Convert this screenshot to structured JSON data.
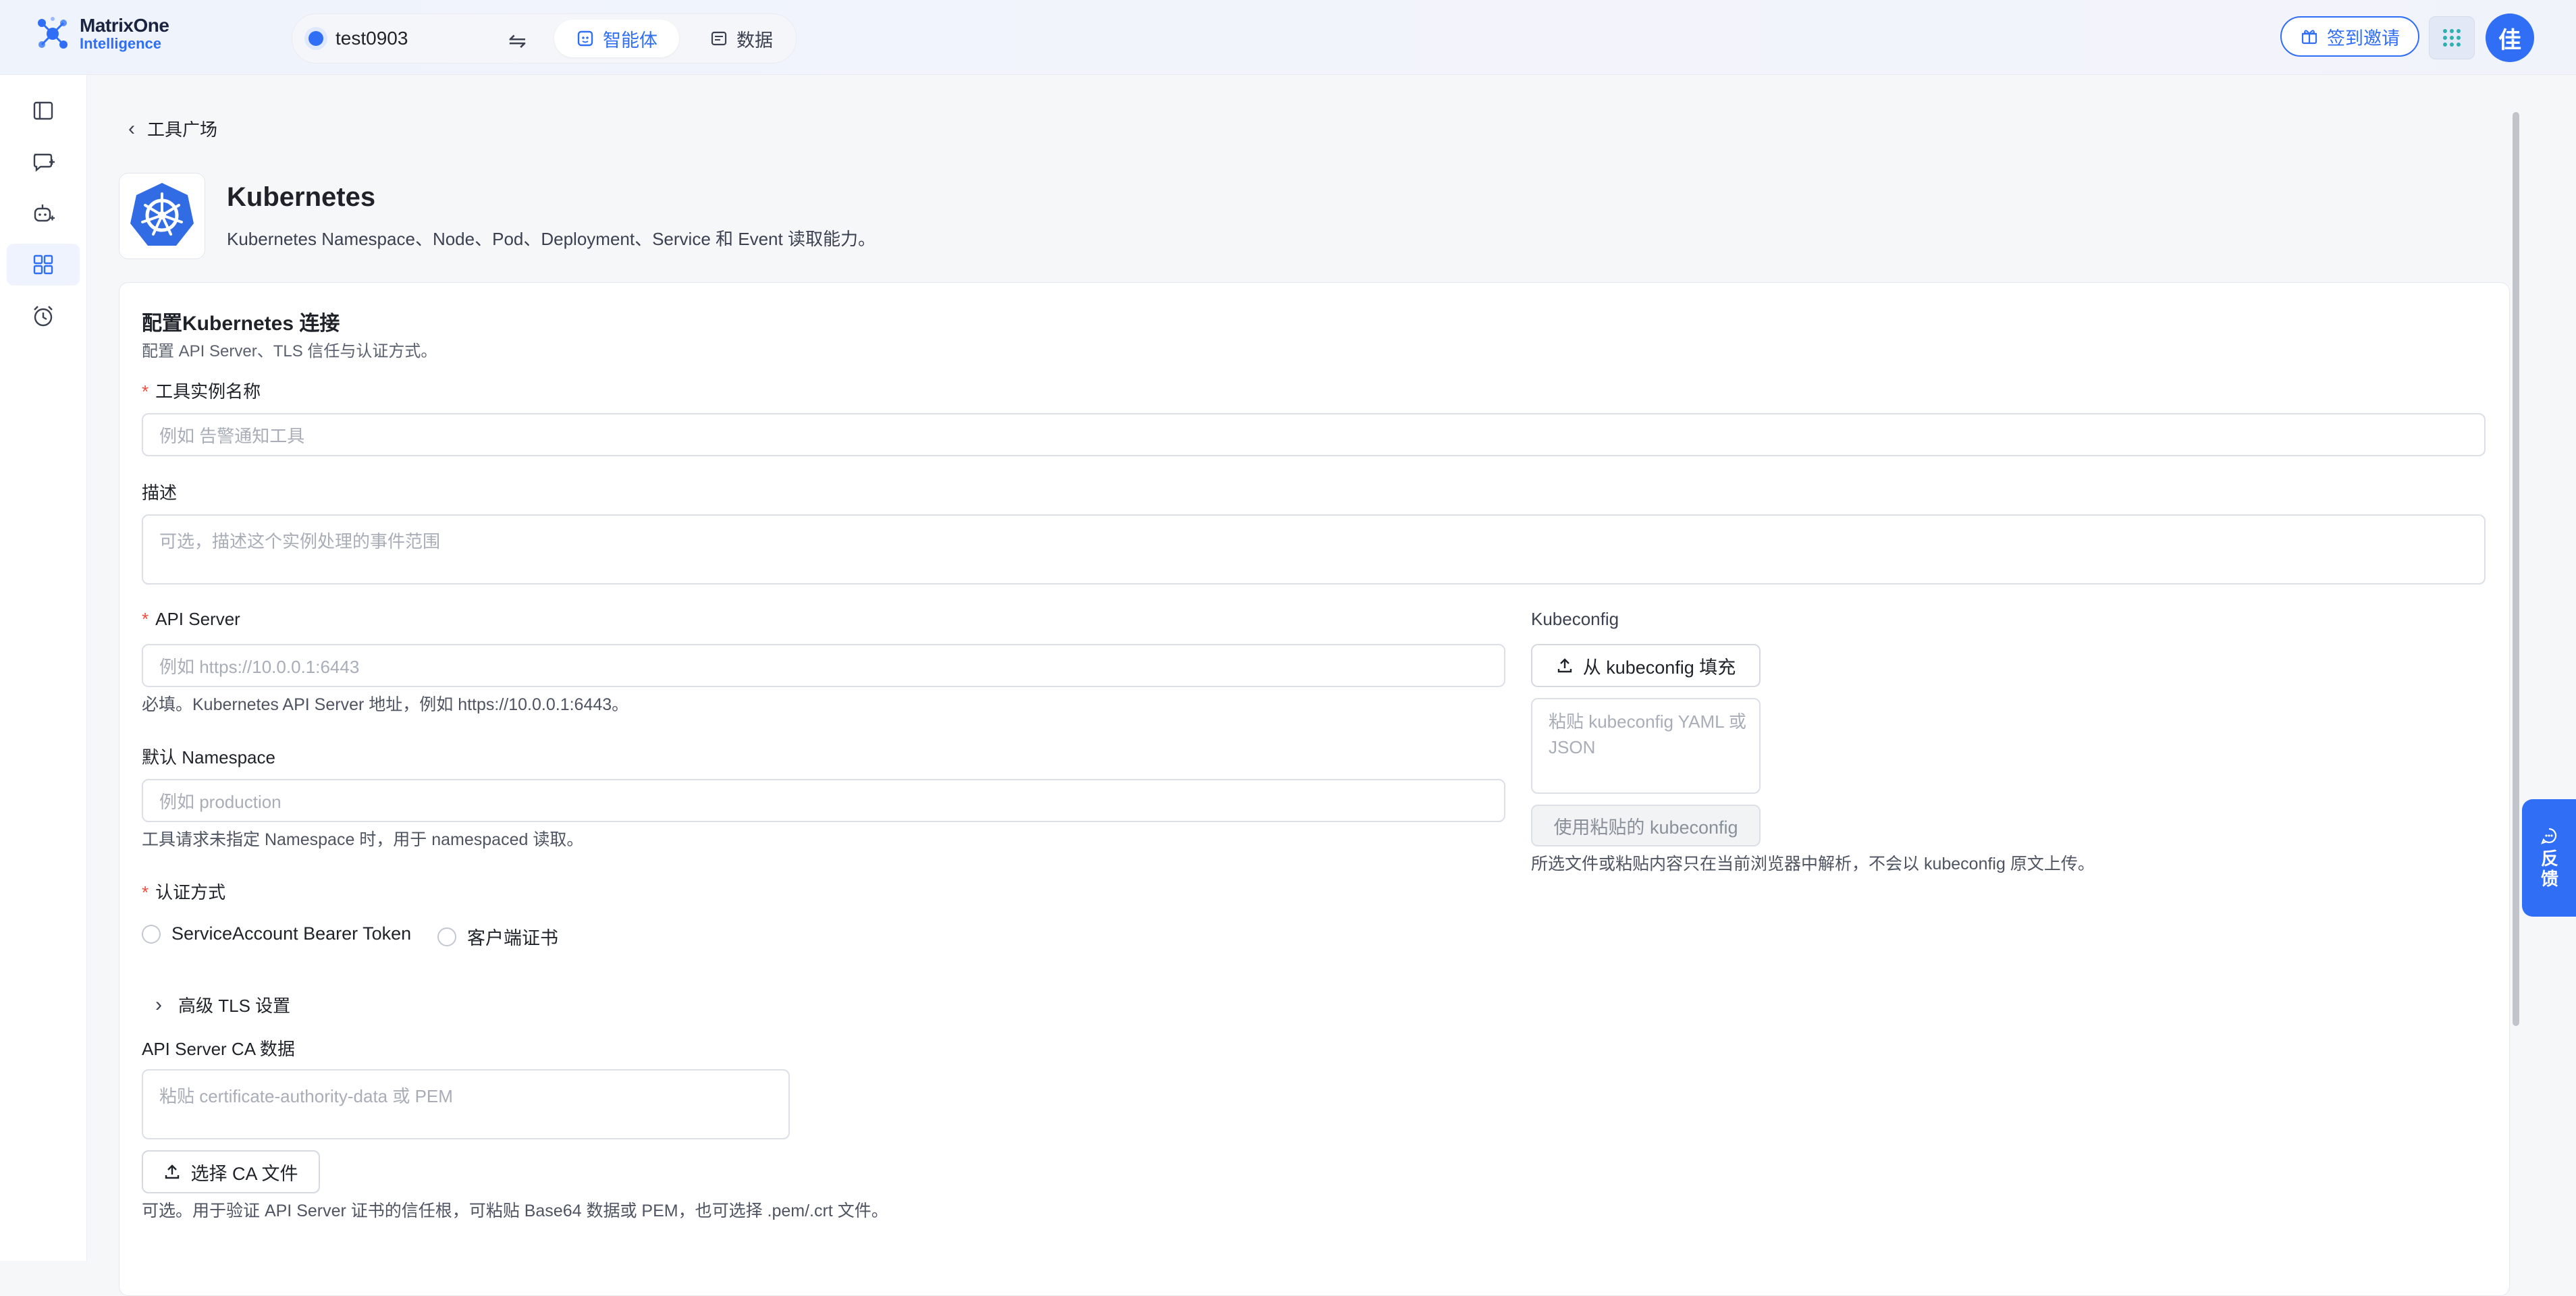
{
  "header": {
    "brand_name": "MatrixOne",
    "brand_sub": "Intelligence",
    "workspace": "test0903",
    "tabs": [
      {
        "label": "智能体",
        "icon": "agent-icon",
        "active": true
      },
      {
        "label": "数据",
        "icon": "data-icon",
        "active": false
      }
    ],
    "invite_label": "签到邀请",
    "avatar_initial": "佳",
    "accent_color": "#2f6ef5"
  },
  "sidebar": {
    "items": [
      {
        "icon": "sidebar-toggle-icon",
        "active": false
      },
      {
        "icon": "new-chat-icon",
        "active": false
      },
      {
        "icon": "agent-robot-icon",
        "active": false
      },
      {
        "icon": "grid-apps-icon",
        "active": true
      },
      {
        "icon": "alarm-clock-icon",
        "active": false
      }
    ]
  },
  "breadcrumb": {
    "back_label": "工具广场"
  },
  "tool": {
    "name": "Kubernetes",
    "description": "Kubernetes Namespace、Node、Pod、Deployment、Service 和 Event 读取能力。"
  },
  "form": {
    "title": "配置Kubernetes 连接",
    "subtitle": "配置 API Server、TLS 信任与认证方式。",
    "instance_name": {
      "label": "工具实例名称",
      "required": true,
      "placeholder": "例如 告警通知工具"
    },
    "description": {
      "label": "描述",
      "placeholder": "可选，描述这个实例处理的事件范围"
    },
    "api_server": {
      "label": "API Server",
      "required": true,
      "placeholder": "例如 https://10.0.0.1:6443",
      "help": "必填。Kubernetes API Server 地址，例如 https://10.0.0.1:6443。"
    },
    "namespace": {
      "label": "默认 Namespace",
      "placeholder": "例如 production",
      "help": "工具请求未指定 Namespace 时，用于 namespaced 读取。"
    },
    "kubeconfig": {
      "label": "Kubeconfig",
      "fill_button": "从 kubeconfig 填充",
      "paste_placeholder": "粘贴 kubeconfig YAML 或 JSON",
      "use_button": "使用粘贴的 kubeconfig",
      "help": "所选文件或粘贴内容只在当前浏览器中解析，不会以 kubeconfig 原文上传。"
    },
    "auth": {
      "label": "认证方式",
      "required": true,
      "options": [
        "ServiceAccount Bearer Token",
        "客户端证书"
      ]
    },
    "advanced_tls_label": "高级 TLS 设置",
    "ca": {
      "label": "API Server CA 数据",
      "placeholder": "粘贴 certificate-authority-data 或 PEM",
      "select_button": "选择 CA 文件",
      "help": "可选。用于验证 API Server 证书的信任根，可粘贴 Base64 数据或 PEM，也可选择 .pem/.crt 文件。"
    }
  },
  "feedback_label": "反馈"
}
